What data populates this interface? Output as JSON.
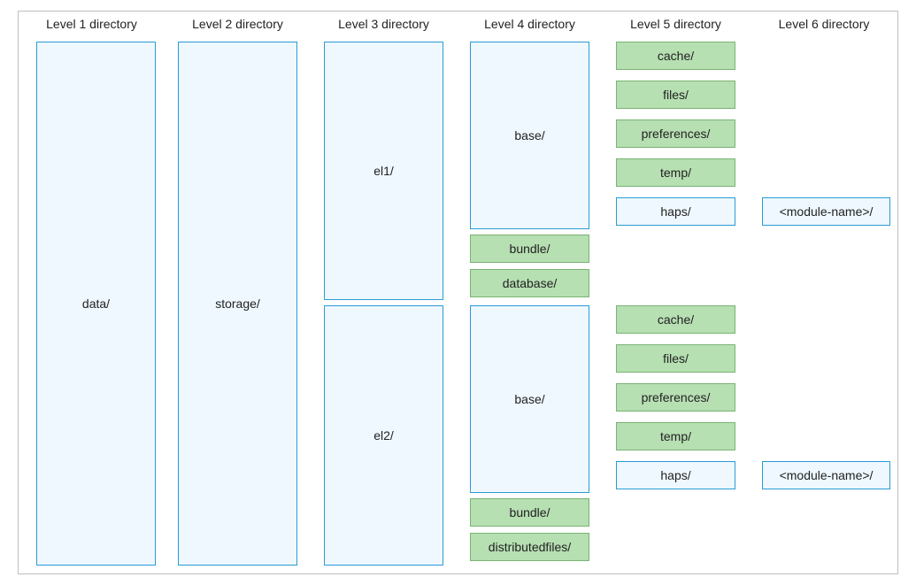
{
  "headers": {
    "l1": "Level 1 directory",
    "l2": "Level 2 directory",
    "l3": "Level 3 directory",
    "l4": "Level 4 directory",
    "l5": "Level 5 directory",
    "l6": "Level 6 directory"
  },
  "l1": {
    "data": "data/"
  },
  "l2": {
    "storage": "storage/"
  },
  "l3": {
    "el1": "el1/",
    "el2": "el2/"
  },
  "l4": {
    "el1": {
      "base": "base/",
      "bundle": "bundle/",
      "database": "database/"
    },
    "el2": {
      "base": "base/",
      "bundle": "bundle/",
      "distributedfiles": "distributedfiles/"
    }
  },
  "l5": {
    "el1": {
      "cache": "cache/",
      "files": "files/",
      "preferences": "preferences/",
      "temp": "temp/",
      "haps": "haps/"
    },
    "el2": {
      "cache": "cache/",
      "files": "files/",
      "preferences": "preferences/",
      "temp": "temp/",
      "haps": "haps/"
    }
  },
  "l6": {
    "el1": {
      "module": "<module-name>/"
    },
    "el2": {
      "module": "<module-name>/"
    }
  }
}
